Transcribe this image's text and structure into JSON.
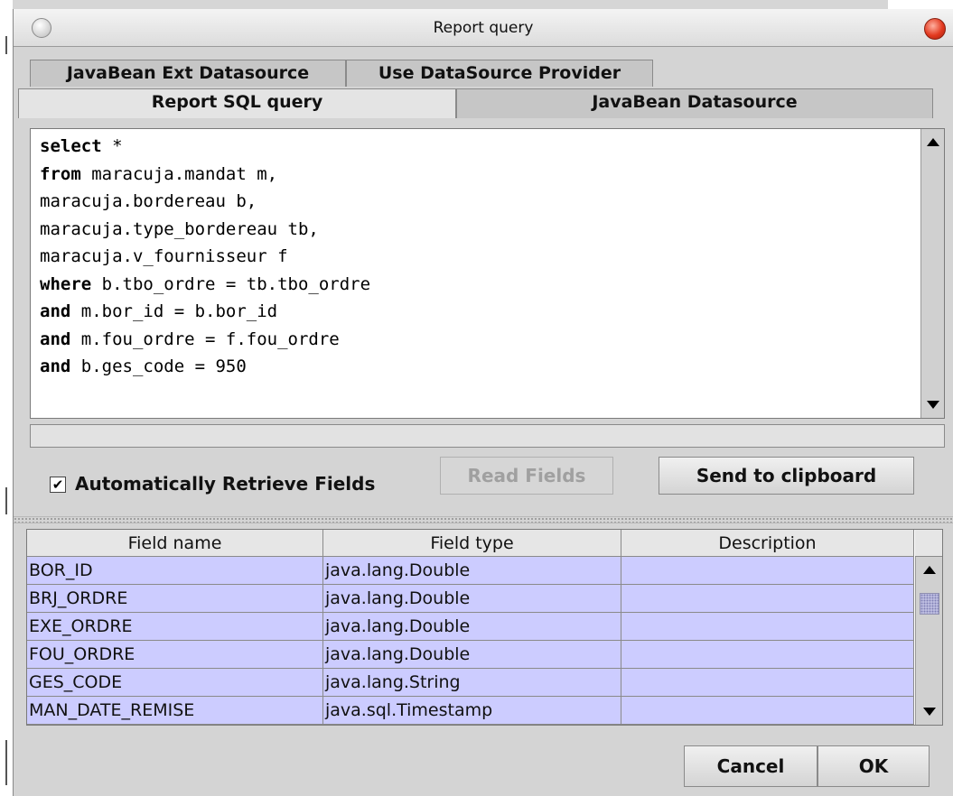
{
  "window": {
    "title": "Report query"
  },
  "tabs": {
    "back_row": [
      "JavaBean Ext Datasource",
      "Use DataSource Provider"
    ],
    "front_row": [
      "Report SQL query",
      "JavaBean Datasource"
    ],
    "active": "Report SQL query"
  },
  "query": {
    "lines": [
      {
        "keyword": "select",
        "rest": " *"
      },
      {
        "keyword": "from",
        "rest": " maracuja.mandat m,"
      },
      {
        "keyword": "",
        "rest": "maracuja.bordereau b,"
      },
      {
        "keyword": "",
        "rest": "maracuja.type_bordereau tb,"
      },
      {
        "keyword": "",
        "rest": "maracuja.v_fournisseur f"
      },
      {
        "keyword": "where",
        "rest": " b.tbo_ordre = tb.tbo_ordre"
      },
      {
        "keyword": "and",
        "rest": " m.bor_id = b.bor_id"
      },
      {
        "keyword": "and",
        "rest": " m.fou_ordre = f.fou_ordre"
      },
      {
        "keyword": "and",
        "rest": " b.ges_code = 950"
      }
    ]
  },
  "options": {
    "auto_retrieve_label": "Automatically Retrieve Fields",
    "auto_retrieve_checked": true,
    "check_glyph": "✔",
    "read_fields_label": "Read Fields",
    "send_clipboard_label": "Send to clipboard"
  },
  "fields_table": {
    "columns": [
      "Field name",
      "Field type",
      "Description"
    ],
    "rows": [
      {
        "name": "BOR_ID",
        "type": "java.lang.Double",
        "description": ""
      },
      {
        "name": "BRJ_ORDRE",
        "type": "java.lang.Double",
        "description": ""
      },
      {
        "name": "EXE_ORDRE",
        "type": "java.lang.Double",
        "description": ""
      },
      {
        "name": "FOU_ORDRE",
        "type": "java.lang.Double",
        "description": ""
      },
      {
        "name": "GES_CODE",
        "type": "java.lang.String",
        "description": ""
      },
      {
        "name": "MAN_DATE_REMISE",
        "type": "java.sql.Timestamp",
        "description": ""
      }
    ],
    "row_color": "#ccccff"
  },
  "footer": {
    "cancel_label": "Cancel",
    "ok_label": "OK"
  }
}
